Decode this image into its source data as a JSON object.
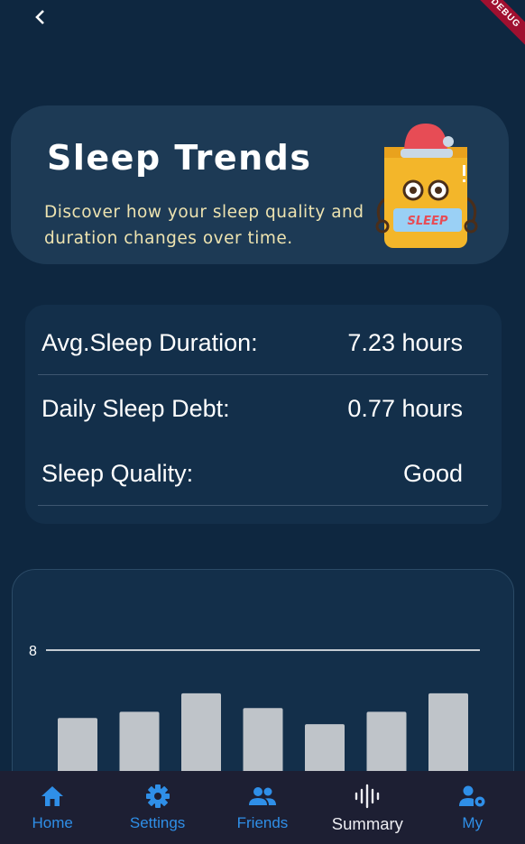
{
  "header": {
    "debug_badge": "DEBUG"
  },
  "hero": {
    "title": "Sleep Trends",
    "subtitle": "Discover how your sleep quality and duration changes over time.",
    "mascot_label": "SLEEP"
  },
  "stats": [
    {
      "label": "Avg.Sleep Duration:",
      "value": "7.23 hours"
    },
    {
      "label": "Daily Sleep Debt:",
      "value": "0.77 hours"
    },
    {
      "label": "Sleep Quality:",
      "value": "Good"
    }
  ],
  "chart_data": {
    "type": "bar",
    "values": [
      6.9,
      7.0,
      7.3,
      7.06,
      6.8,
      7.0,
      7.3
    ],
    "y_tick_labels": [
      "8"
    ],
    "reference_line": 8,
    "bar_color": "#bfc4c9",
    "grid": false
  },
  "bottom_nav": [
    {
      "label": "Home",
      "icon": "home-icon",
      "active": false
    },
    {
      "label": "Settings",
      "icon": "gear-icon",
      "active": false
    },
    {
      "label": "Friends",
      "icon": "people-icon",
      "active": false
    },
    {
      "label": "Summary",
      "icon": "waveform-icon",
      "active": true
    },
    {
      "label": "My",
      "icon": "user-settings-icon",
      "active": false
    }
  ],
  "colors": {
    "background": "#0e2740",
    "card": "#132f4a",
    "hero": "#1d3a55",
    "nav_bg": "#1d1f33",
    "nav_accent": "#2f8fe8"
  }
}
